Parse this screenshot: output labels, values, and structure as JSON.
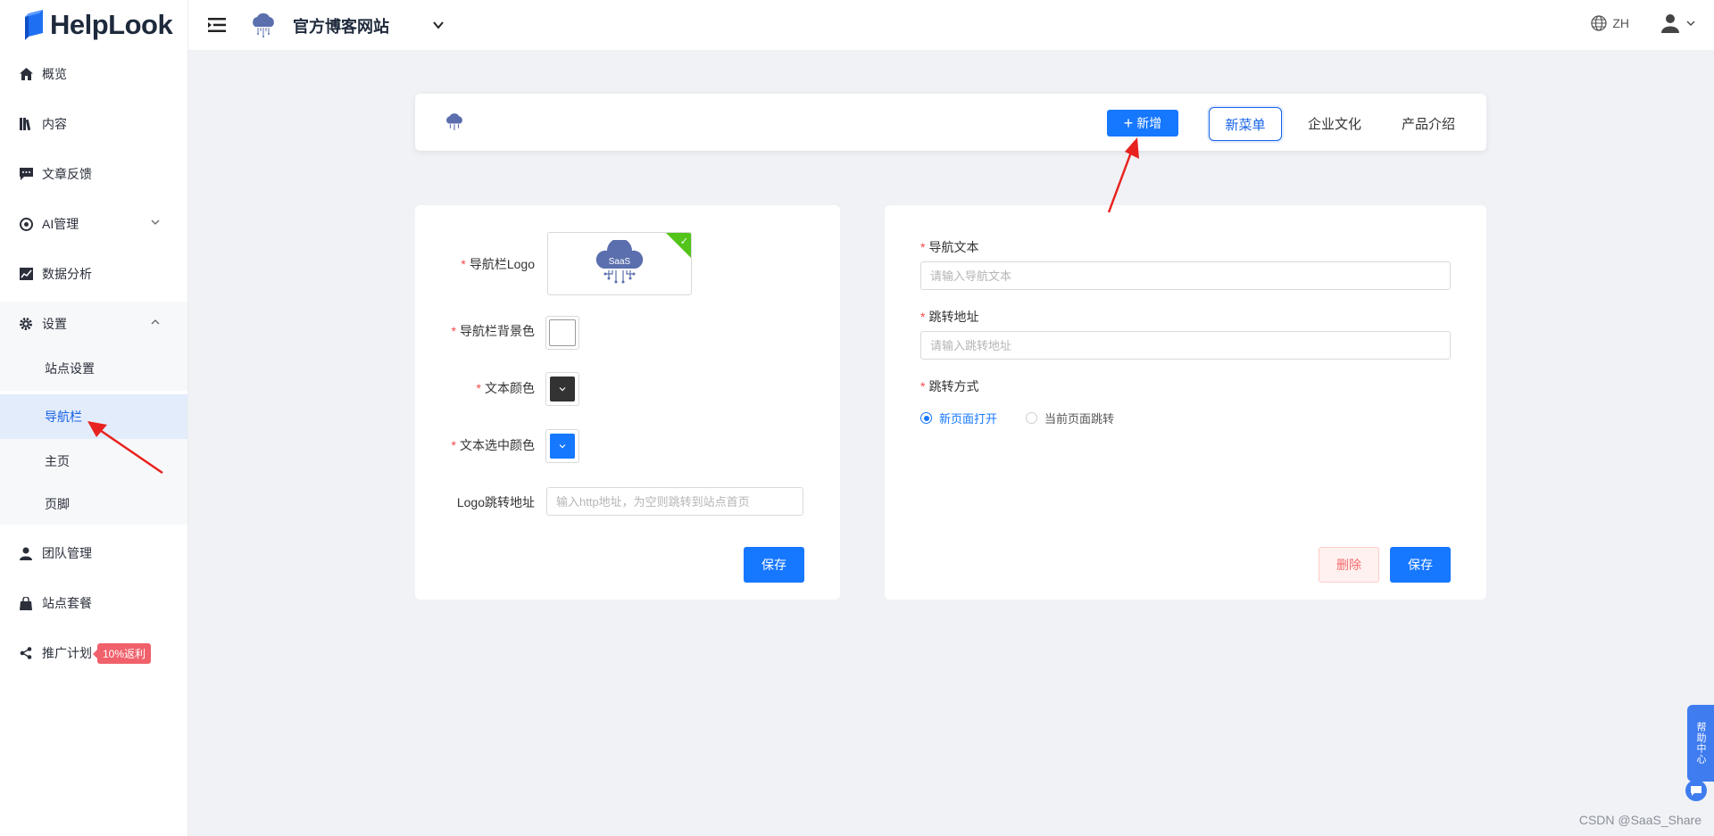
{
  "brand": {
    "name": "HelpLook"
  },
  "header": {
    "site_title": "官方博客网站",
    "lang": "ZH"
  },
  "sidebar": {
    "items": [
      {
        "label": "概览",
        "icon": "home-icon"
      },
      {
        "label": "内容",
        "icon": "book-icon"
      },
      {
        "label": "文章反馈",
        "icon": "comment-icon"
      },
      {
        "label": "AI管理",
        "icon": "ai-icon"
      },
      {
        "label": "数据分析",
        "icon": "chart-icon"
      },
      {
        "label": "设置",
        "icon": "gear-icon"
      },
      {
        "label": "团队管理",
        "icon": "user-icon"
      },
      {
        "label": "站点套餐",
        "icon": "bag-icon"
      },
      {
        "label": "推广计划",
        "icon": "share-icon"
      }
    ],
    "settings_children": [
      "站点设置",
      "导航栏",
      "主页",
      "页脚"
    ],
    "promo_badge": "10%返利"
  },
  "preview": {
    "add_label": "新增",
    "tabs": [
      "新菜单",
      "企业文化",
      "产品介绍"
    ]
  },
  "left_form": {
    "logo_label": "导航栏Logo",
    "logo_text": "SaaS",
    "bg_color_label": "导航栏背景色",
    "bg_color": "#ffffff",
    "text_color_label": "文本颜色",
    "text_color": "#333333",
    "selected_color_label": "文本选中颜色",
    "selected_color": "#1677ff",
    "logo_link_label": "Logo跳转地址",
    "logo_link_placeholder": "输入http地址，为空则跳转到站点首页",
    "save_label": "保存"
  },
  "right_form": {
    "nav_text_label": "导航文本",
    "nav_text_placeholder": "请输入导航文本",
    "link_label": "跳转地址",
    "link_placeholder": "请输入跳转地址",
    "open_mode_label": "跳转方式",
    "open_options": [
      "新页面打开",
      "当前页面跳转"
    ],
    "delete_label": "删除",
    "save_label": "保存"
  },
  "float_widget": {
    "label": "帮助中心"
  },
  "watermark": "CSDN @SaaS_Share",
  "colors": {
    "primary": "#1677ff",
    "active_text": "#1763e6",
    "danger": "#f26b6b",
    "success": "#52c41a",
    "arrow": "#e8231f"
  }
}
